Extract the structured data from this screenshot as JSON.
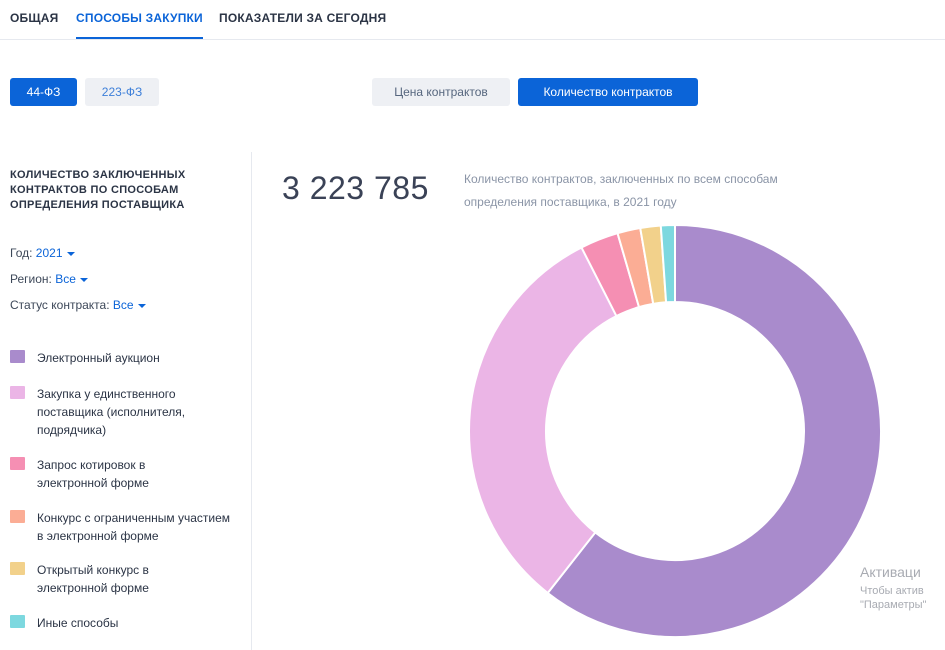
{
  "tabs": [
    {
      "label": "ОБЩАЯ"
    },
    {
      "label": "СПОСОБЫ ЗАКУПКИ"
    },
    {
      "label": "ПОКАЗАТЕЛИ ЗА СЕГОДНЯ"
    }
  ],
  "law_toggle": {
    "fz44": "44-ФЗ",
    "fz223": "223-ФЗ"
  },
  "metric_toggle": {
    "price": "Цена контрактов",
    "count": "Количество контрактов"
  },
  "sidebar": {
    "title": "КОЛИЧЕСТВО ЗАКЛЮЧЕННЫХ КОНТРАКТОВ ПО СПОСОБАМ ОПРЕДЕЛЕНИЯ ПОСТАВЩИКА",
    "filters": {
      "year_label": "Год:",
      "year_value": "2021",
      "region_label": "Регион:",
      "region_value": "Все",
      "status_label": "Статус контракта:",
      "status_value": "Все"
    }
  },
  "summary": {
    "total": "3 223 785",
    "description": "Количество контрактов, заключенных по всем способам определения поставщика, в 2021 году"
  },
  "watermark": {
    "line1": "Активаци",
    "line2": "Чтобы актив",
    "line3": "\"Параметры\""
  },
  "chart_data": {
    "type": "pie",
    "donut": true,
    "series": [
      {
        "name": "Электронный аукцион",
        "value": 60.6,
        "color": "#a98bcc"
      },
      {
        "name": "Закупка у единственного поставщика (исполнителя, подрядчика)",
        "value": 31.9,
        "color": "#ebb5e6"
      },
      {
        "name": "Запрос котировок в электронной форме",
        "value": 3.0,
        "color": "#f58fb3"
      },
      {
        "name": "Конкурс с ограниченным участием в электронной форме",
        "value": 1.8,
        "color": "#fbad95"
      },
      {
        "name": "Открытый конкурс в электронной форме",
        "value": 1.6,
        "color": "#f2d18b"
      },
      {
        "name": "Иные способы",
        "value": 1.1,
        "color": "#7dd8df"
      }
    ]
  }
}
